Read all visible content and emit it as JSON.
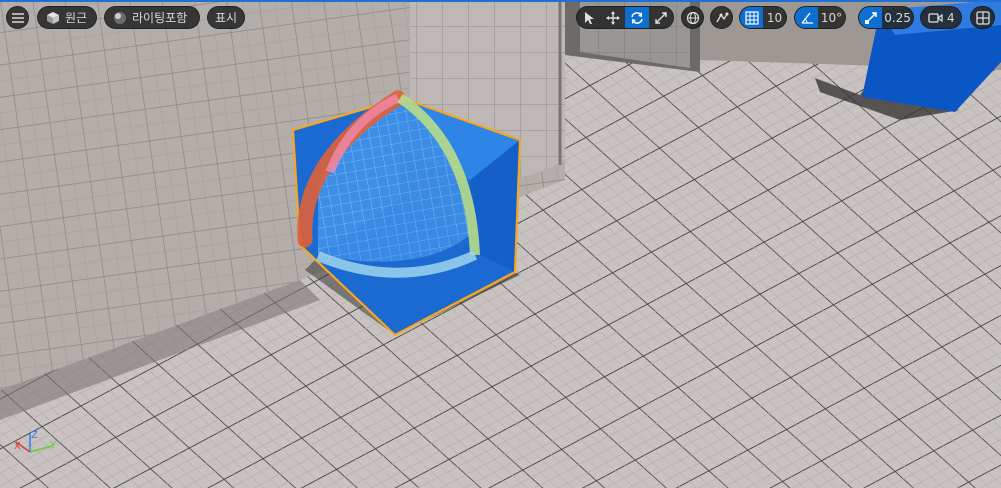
{
  "toolbar": {
    "menu_icon": "hamburger-icon",
    "perspective": {
      "label": "원근",
      "icon": "cube-icon"
    },
    "view_mode": {
      "label": "라이팅포함",
      "icon": "sphere-lit-icon"
    },
    "show": {
      "label": "표시"
    },
    "transform_tools": {
      "items": [
        {
          "name": "select",
          "icon": "cursor-icon",
          "active": false
        },
        {
          "name": "move",
          "icon": "move-arrows-icon",
          "active": false
        },
        {
          "name": "rotate",
          "icon": "rotate-icon",
          "active": true
        },
        {
          "name": "scale",
          "icon": "scale-icon",
          "active": false
        }
      ]
    },
    "world_local_icon": "globe-icon",
    "surface_snap_icon": "surface-snap-icon",
    "grid_snap": {
      "icon": "grid-icon",
      "value": "10",
      "active": true
    },
    "rotation_snap": {
      "icon": "angle-icon",
      "value": "10°",
      "active": true
    },
    "scale_snap": {
      "icon": "scale-snap-icon",
      "value": "0.25",
      "active": true
    },
    "camera_speed": {
      "icon": "camera-icon",
      "value": "4"
    },
    "layout_icon": "viewport-layout-icon"
  },
  "axis_gizmo": {
    "x": "X",
    "y": "Y",
    "z": "Z"
  },
  "colors": {
    "accent": "#0f6fd1",
    "cube": "#1f73d6",
    "selection_outline": "#f5a623",
    "rotate_ring_x": "#e0603a",
    "rotate_ring_y": "#9bd64a",
    "axis_x": "#e03c3c",
    "axis_y": "#5fcf3a",
    "axis_z": "#3c7cf0"
  }
}
